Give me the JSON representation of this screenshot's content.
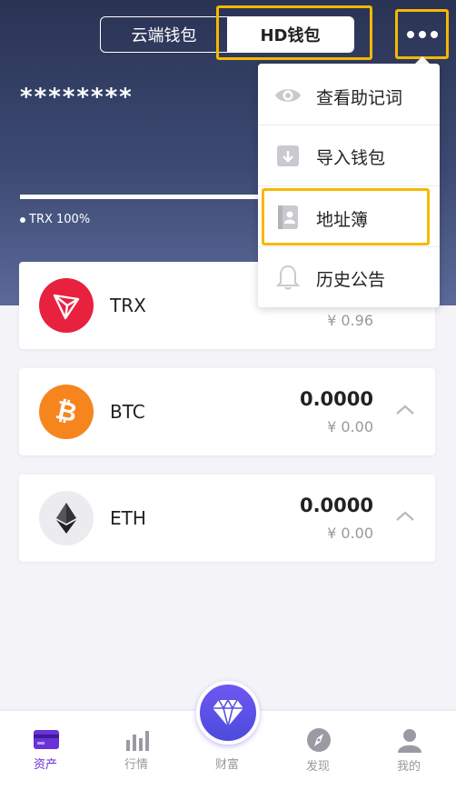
{
  "header": {
    "tabs": [
      {
        "label": "云端钱包",
        "active": false
      },
      {
        "label": "HD钱包",
        "active": true
      }
    ],
    "more_icon": "more-horizontal-icon",
    "balance_masked": "********",
    "allocation_label": "TRX 100%"
  },
  "coins": [
    {
      "name": "TRX",
      "amount": "",
      "fiat": "¥ 0.96",
      "color": "#e8213f",
      "icon": "tron-logo-icon"
    },
    {
      "name": "BTC",
      "amount": "0.0000",
      "fiat": "¥ 0.00",
      "color": "#f7851d",
      "icon": "bitcoin-logo-icon"
    },
    {
      "name": "ETH",
      "amount": "0.0000",
      "fiat": "¥ 0.00",
      "color": "#ececf0",
      "icon": "ethereum-logo-icon"
    }
  ],
  "menu": {
    "items": [
      {
        "label": "查看助记词",
        "icon": "eye-icon"
      },
      {
        "label": "导入钱包",
        "icon": "import-wallet-icon"
      },
      {
        "label": "地址簿",
        "icon": "address-book-icon"
      },
      {
        "label": "历史公告",
        "icon": "bell-icon"
      }
    ]
  },
  "tabbar": {
    "items": [
      {
        "label": "资产",
        "icon": "wallet-card-icon",
        "active": true
      },
      {
        "label": "行情",
        "icon": "bar-chart-icon",
        "active": false
      },
      {
        "label": "财富",
        "icon": "diamond-icon",
        "active": false
      },
      {
        "label": "发现",
        "icon": "compass-icon",
        "active": false
      },
      {
        "label": "我的",
        "icon": "user-icon",
        "active": false
      }
    ]
  },
  "colors": {
    "accent": "#6a32d9",
    "highlight": "#f5b800",
    "header_top": "#2a3354",
    "header_bottom": "#5b6a99"
  }
}
